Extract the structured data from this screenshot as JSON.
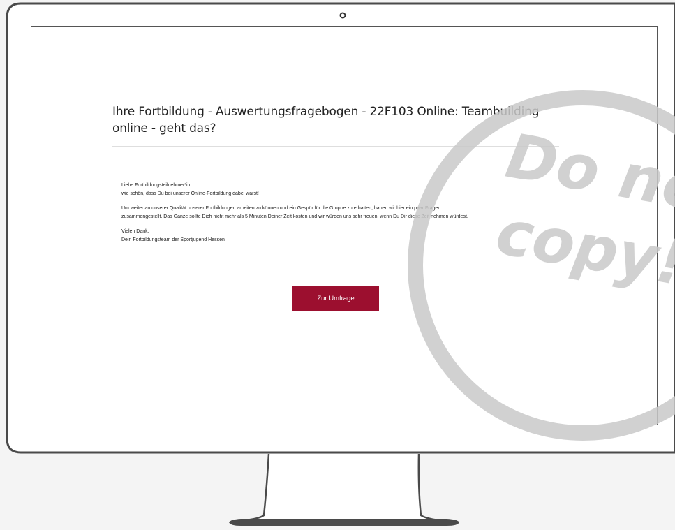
{
  "survey": {
    "title": "Ihre Fortbildung - Auswertungsfragebogen - 22F103 Online: Teambuilding online - geht das?",
    "greeting": "Liebe Fortbildungsteilnehmer*in,",
    "intro": "wie schön, dass Du bei unserer Online-Fortbildung dabei warst!",
    "body_line_1": "Um weiter an unserer Qualität unserer Fortbildungen arbeiten zu können und ein Gespür für die Gruppe zu erhalten, haben wir hier ein paar Fragen",
    "body_line_2": "zusammengestellt. Das Ganze sollte Dich nicht mehr als 5 Minuten Deiner Zeit kosten und wir würden uns sehr freuen, wenn Du Dir diese Zeit nehmen würdest.",
    "thanks": "Vielen Dank,",
    "signature": "Dein Fortbildungsteam der Sportjugend Hessen",
    "button_label": "Zur Umfrage"
  },
  "watermark": {
    "text_line_1": "Do not",
    "text_line_2": "copy!"
  },
  "colors": {
    "accent": "#9c0f2f",
    "watermark": "#c9c9c9",
    "frame": "#4a4a4a"
  }
}
